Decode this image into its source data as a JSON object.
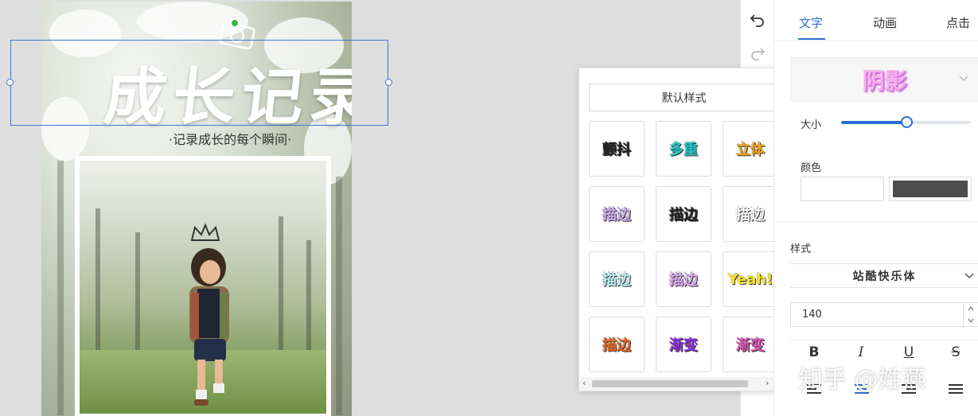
{
  "poster": {
    "title": "成长记录",
    "subtitle": "·记录成长的每个瞬间·"
  },
  "style_popup": {
    "default_button": "默认样式",
    "tiles": [
      {
        "label": "颤抖",
        "color": "#222222"
      },
      {
        "label": "多重",
        "color": "#22c5c9"
      },
      {
        "label": "立体",
        "color": "#f4a21e"
      },
      {
        "label": "描边",
        "color": "#c9a6ee"
      },
      {
        "label": "描边",
        "color": "#222222"
      },
      {
        "label": "描边",
        "color": "#ffffff"
      },
      {
        "label": "描边",
        "color": "#b6ecf2"
      },
      {
        "label": "描边",
        "color": "#d9a6f0"
      },
      {
        "label": "Yeah!",
        "color": "#f8e222"
      },
      {
        "label": "描边",
        "color": "#e8661d"
      },
      {
        "label": "渐变",
        "color": "#8a2be2"
      },
      {
        "label": "渐变",
        "color": "#d94fb2"
      }
    ]
  },
  "panel": {
    "tabs": [
      "文字",
      "动画",
      "点击"
    ],
    "active_tab": "文字",
    "effect": "阴影",
    "size_label": "大小",
    "size_level": 0.5,
    "color_label": "颜色",
    "color_value": "#4d4d4d",
    "style_label": "样式",
    "font_name": "站酷快乐体",
    "font_size": "140",
    "format_buttons": [
      "B",
      "I",
      "U",
      "S"
    ],
    "accent_color": "#2b6fd6"
  },
  "watermark": "知乎 @姓燕"
}
